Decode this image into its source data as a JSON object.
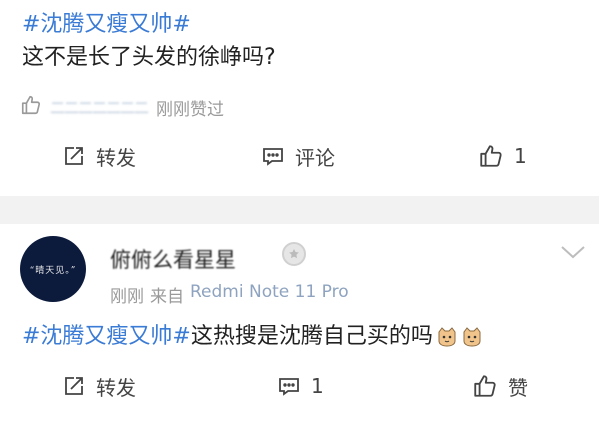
{
  "post1": {
    "topic": "#沈腾又瘦又帅#",
    "text": "这不是长了头发的徐峥吗?",
    "likers_names": "二二二二二二二",
    "likers_status": "刚刚赞过",
    "actions": {
      "repost": "转发",
      "comment": "评论",
      "like_count": "1"
    }
  },
  "post2": {
    "avatar_text": "“晴天见。”",
    "username": "俯俯么看星星",
    "time": "刚刚",
    "source_prefix": "来自",
    "device": "Redmi Note 11 Pro",
    "topic": "#沈腾又瘦又帅#",
    "text": "这热搜是沈腾自己买的吗",
    "actions": {
      "repost": "转发",
      "comment_count": "1",
      "like": "赞"
    }
  },
  "icons": [
    "thumb-up-icon",
    "repost-icon",
    "comment-icon",
    "chevron-down-icon",
    "badge-icon",
    "cat-emoji-icon"
  ],
  "colors": {
    "topic": "#3a7bd5",
    "muted": "#9a9a9a",
    "divider": "#f2f2f2",
    "avatar_bg": "#0c1a3c"
  }
}
